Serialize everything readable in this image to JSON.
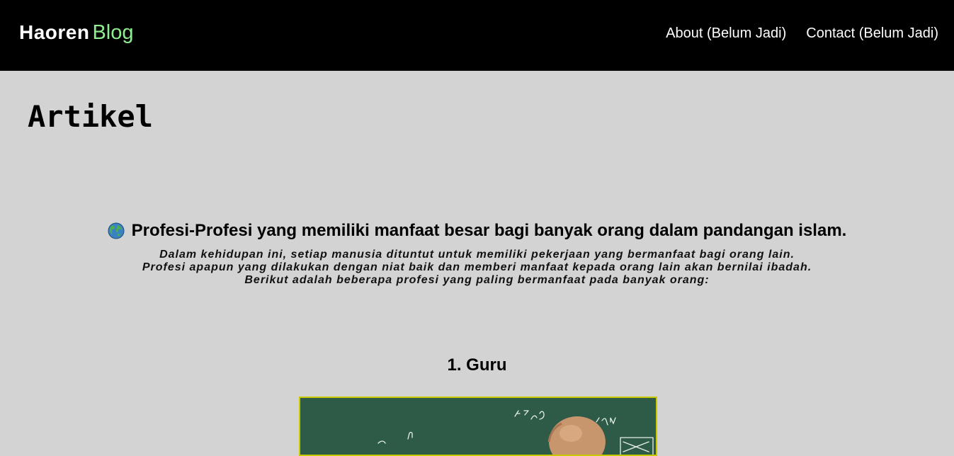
{
  "header": {
    "brand_main": "Haoren",
    "brand_accent": "Blog",
    "nav": [
      {
        "label": "About (Belum Jadi)"
      },
      {
        "label": "Contact (Belum Jadi)"
      }
    ]
  },
  "page": {
    "title": "Artikel"
  },
  "article": {
    "icon": "globe-icon",
    "heading": "Profesi-Profesi yang memiliki manfaat besar bagi banyak orang dalam pandangan islam.",
    "intro_lines": [
      "Dalam kehidupan ini, setiap manusia dituntut untuk memiliki pekerjaan yang bermanfaat bagi orang lain.",
      "Profesi apapun yang dilakukan dengan niat baik dan memberi manfaat kepada orang lain akan bernilai ibadah.",
      "Berikut adalah beberapa profesi yang paling bermanfaat pada banyak orang:"
    ],
    "sections": [
      {
        "heading": "1. Guru"
      }
    ]
  },
  "colors": {
    "header_bg": "#000000",
    "page_bg": "#d3d3d3",
    "brand_accent": "#90ee90",
    "image_border": "#c9c900",
    "chalkboard": "#2e5a48"
  }
}
